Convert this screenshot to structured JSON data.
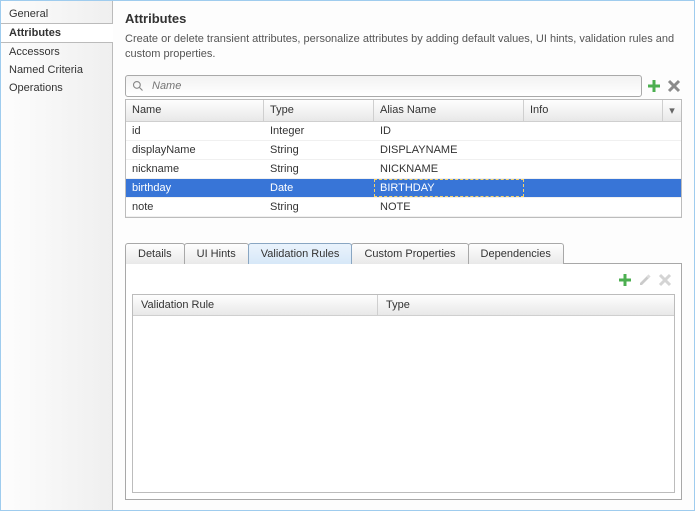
{
  "sidebar": {
    "items": [
      {
        "label": "General",
        "selected": false
      },
      {
        "label": "Attributes",
        "selected": true
      },
      {
        "label": "Accessors",
        "selected": false
      },
      {
        "label": "Named Criteria",
        "selected": false
      },
      {
        "label": "Operations",
        "selected": false
      }
    ]
  },
  "header": {
    "title": "Attributes",
    "description": "Create or delete transient attributes, personalize attributes by adding default values, UI hints, validation rules and custom properties."
  },
  "search": {
    "placeholder": "Name"
  },
  "toolbar": {
    "add": "add-icon",
    "delete": "delete-icon"
  },
  "attributes_table": {
    "columns": {
      "name": "Name",
      "type": "Type",
      "alias": "Alias Name",
      "info": "Info"
    },
    "rows": [
      {
        "name": "id",
        "type": "Integer",
        "alias": "ID",
        "info": "",
        "selected": false
      },
      {
        "name": "displayName",
        "type": "String",
        "alias": "DISPLAYNAME",
        "info": "",
        "selected": false
      },
      {
        "name": "nickname",
        "type": "String",
        "alias": "NICKNAME",
        "info": "",
        "selected": false
      },
      {
        "name": "birthday",
        "type": "Date",
        "alias": "BIRTHDAY",
        "info": "",
        "selected": true
      },
      {
        "name": "note",
        "type": "String",
        "alias": "NOTE",
        "info": "",
        "selected": false
      }
    ]
  },
  "detail_tabs": {
    "items": [
      {
        "label": "Details"
      },
      {
        "label": "UI Hints"
      },
      {
        "label": "Validation Rules"
      },
      {
        "label": "Custom Properties"
      },
      {
        "label": "Dependencies"
      }
    ],
    "active_index": 2
  },
  "validation_panel": {
    "columns": {
      "rule": "Validation Rule",
      "type": "Type"
    },
    "rows": []
  }
}
